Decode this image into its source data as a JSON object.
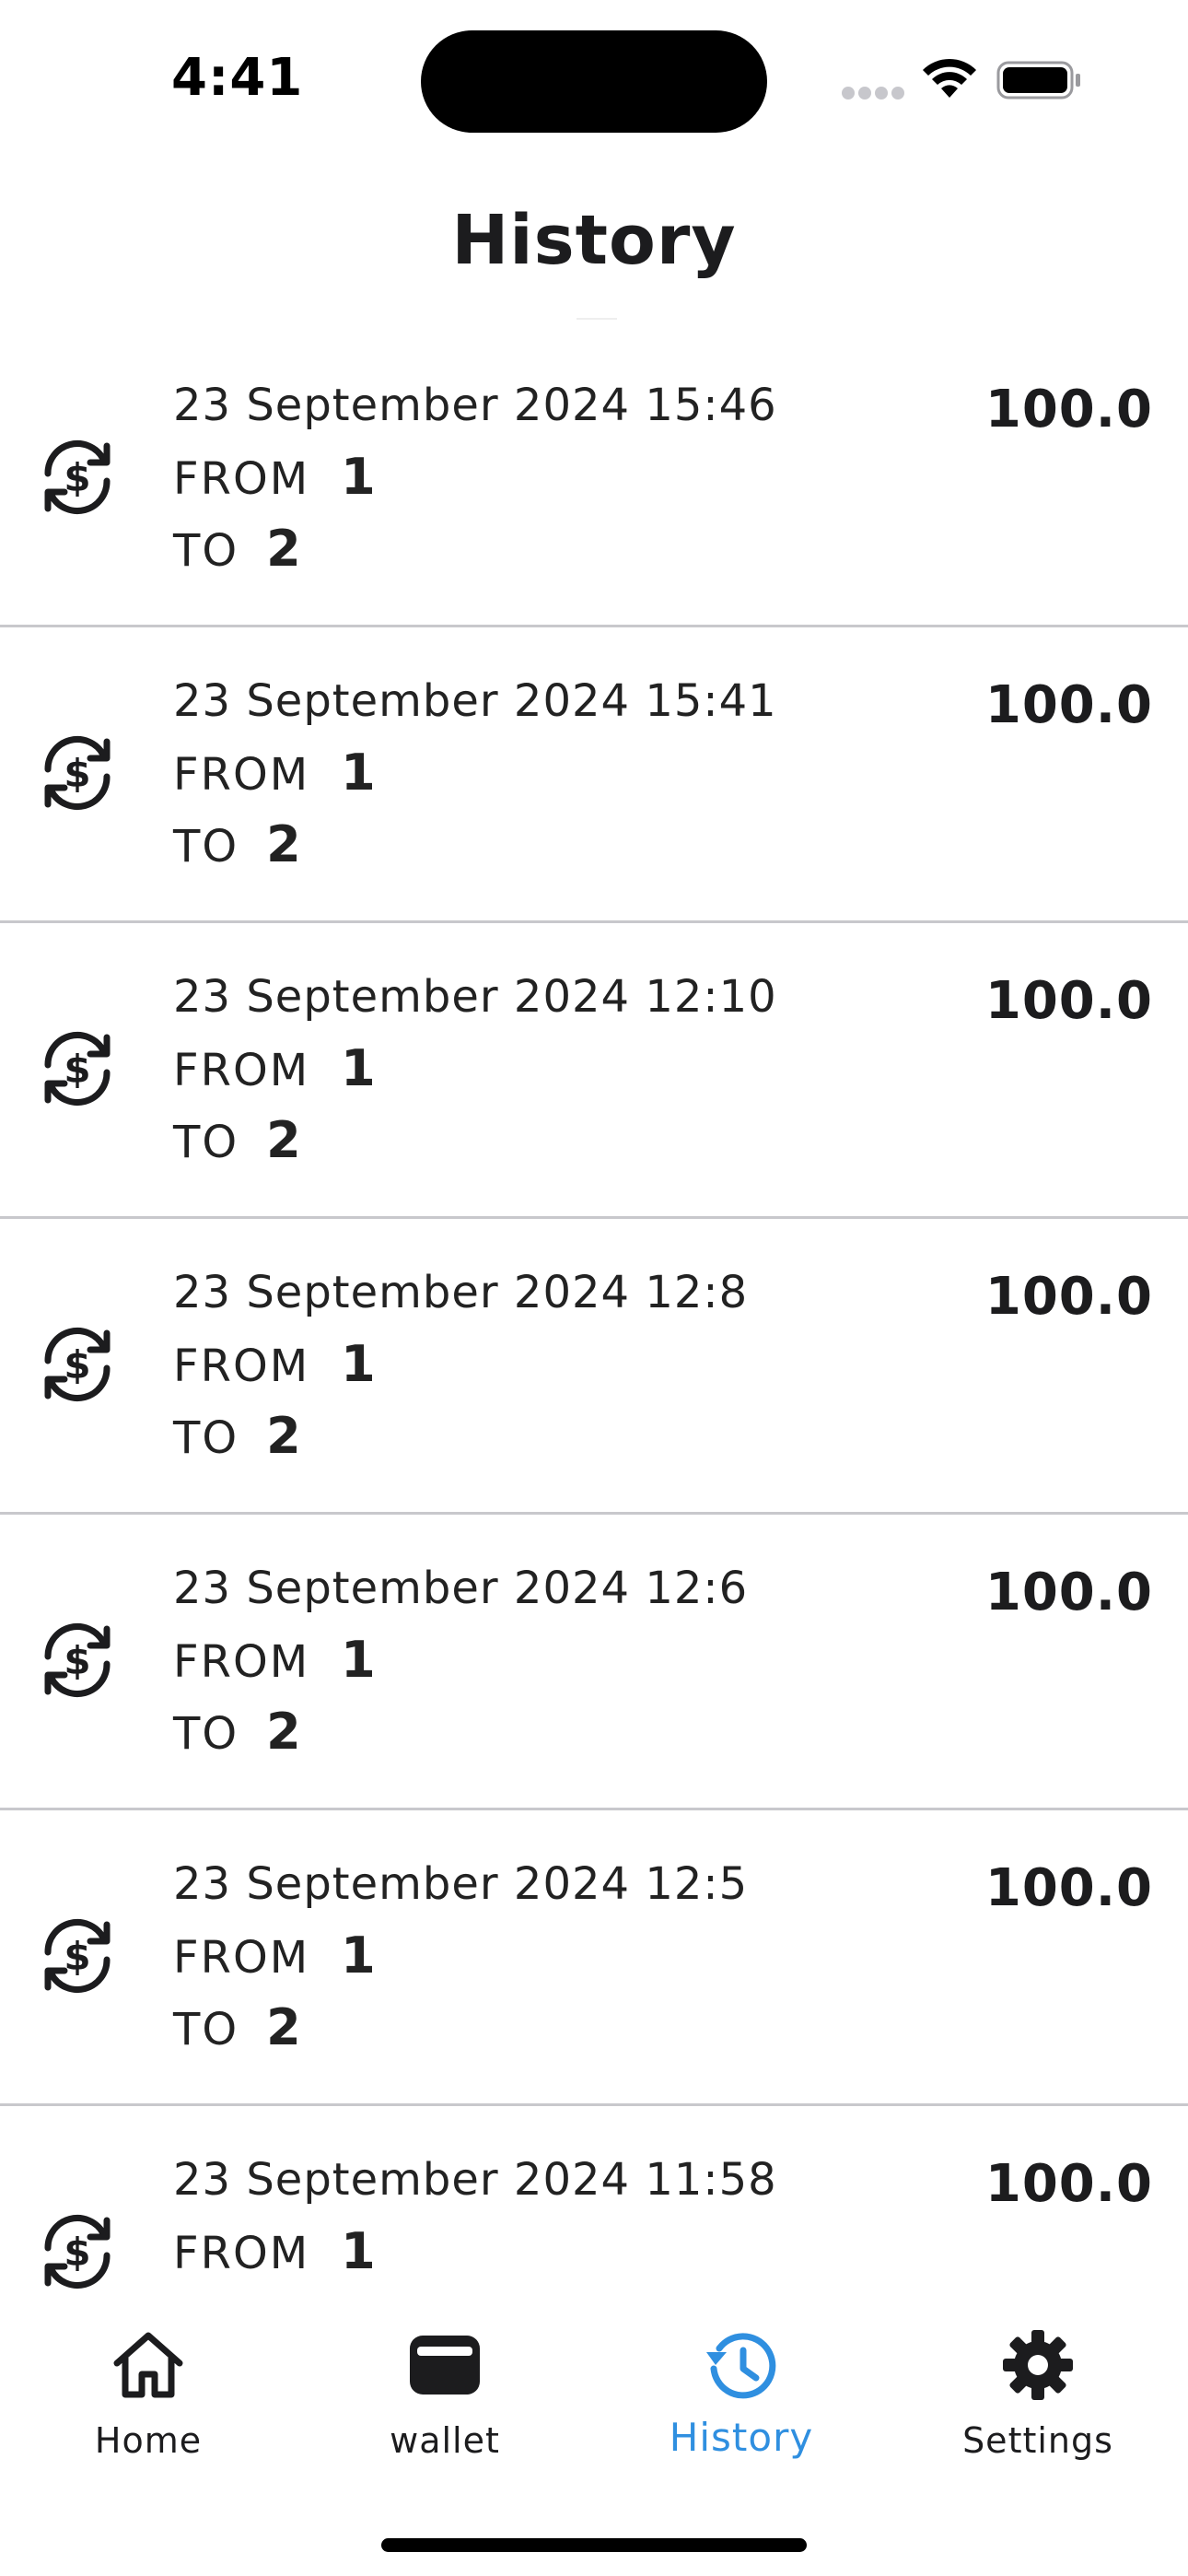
{
  "status_bar": {
    "time": "4:41"
  },
  "header": {
    "title": "History"
  },
  "history": [
    {
      "date": "23 September 2024 15:46",
      "from_label": "FROM",
      "from_value": "1",
      "to_label": "TO",
      "to_value": "2",
      "amount": "100.0",
      "icon": "currency-exchange-icon"
    },
    {
      "date": "23 September 2024 15:41",
      "from_label": "FROM",
      "from_value": "1",
      "to_label": "TO",
      "to_value": "2",
      "amount": "100.0",
      "icon": "currency-exchange-icon"
    },
    {
      "date": "23 September 2024 12:10",
      "from_label": "FROM",
      "from_value": "1",
      "to_label": "TO",
      "to_value": "2",
      "amount": "100.0",
      "icon": "currency-exchange-icon"
    },
    {
      "date": "23 September 2024 12:8",
      "from_label": "FROM",
      "from_value": "1",
      "to_label": "TO",
      "to_value": "2",
      "amount": "100.0",
      "icon": "currency-exchange-icon"
    },
    {
      "date": "23 September 2024 12:6",
      "from_label": "FROM",
      "from_value": "1",
      "to_label": "TO",
      "to_value": "2",
      "amount": "100.0",
      "icon": "currency-exchange-icon"
    },
    {
      "date": "23 September 2024 12:5",
      "from_label": "FROM",
      "from_value": "1",
      "to_label": "TO",
      "to_value": "2",
      "amount": "100.0",
      "icon": "currency-exchange-icon"
    },
    {
      "date": "23 September 2024 11:58",
      "from_label": "FROM",
      "from_value": "1",
      "amount": "100.0",
      "icon": "currency-exchange-icon"
    }
  ],
  "tab_bar": {
    "items": [
      {
        "label": "Home",
        "icon": "home-icon",
        "active": false
      },
      {
        "label": "wallet",
        "icon": "wallet-icon",
        "active": false
      },
      {
        "label": "History",
        "icon": "history-icon",
        "active": true
      },
      {
        "label": "Settings",
        "icon": "gear-icon",
        "active": false
      }
    ],
    "active_color": "#2f8fe0",
    "inactive_color": "#1c1c1e"
  }
}
